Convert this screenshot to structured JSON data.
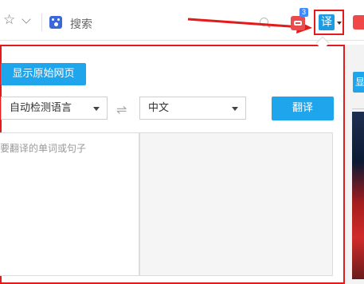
{
  "toolbar": {
    "star_icon": "star-icon",
    "search_text": "搜索",
    "badge_count": "3",
    "translate_icon_label": "译"
  },
  "popup": {
    "show_original_label": "显示原始网页",
    "source_lang": "自动检测语言",
    "swap_icon": "⇌",
    "target_lang": "中文",
    "translate_label": "翻译",
    "input_placeholder": "要翻译的单词或句子"
  },
  "page": {
    "button_label": "显"
  },
  "colors": {
    "accent": "#1ea5ec",
    "highlight": "#e31b1b"
  }
}
